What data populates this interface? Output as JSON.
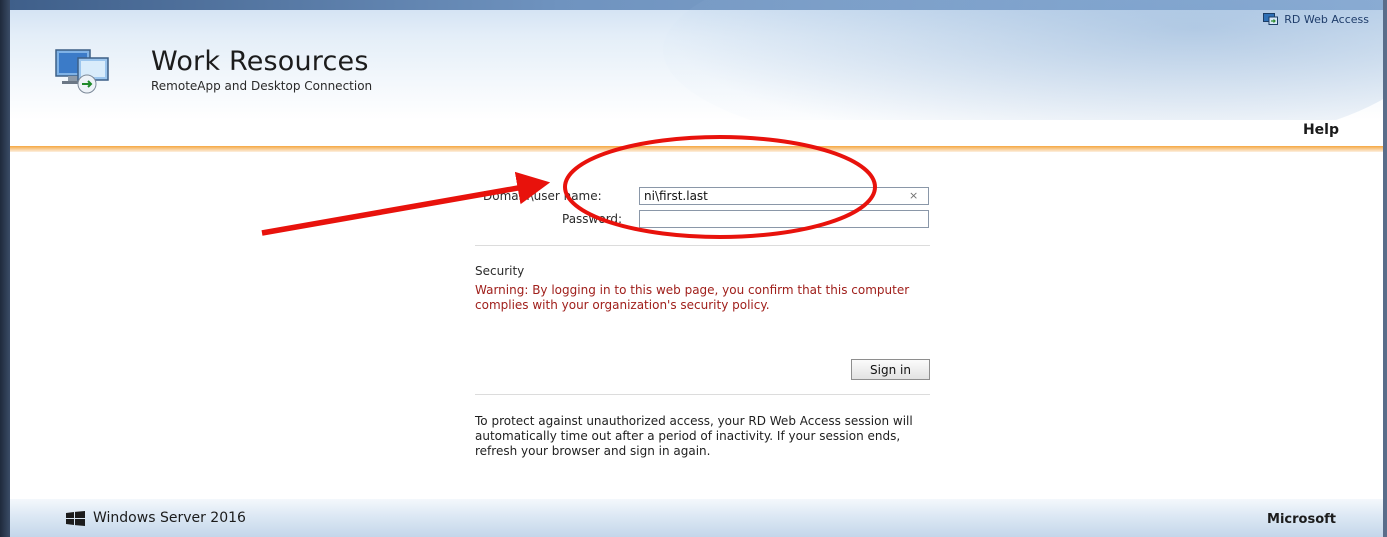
{
  "header": {
    "rd_web_access": "RD Web Access",
    "title": "Work Resources",
    "subtitle": "RemoteApp and Desktop Connection",
    "help": "Help"
  },
  "login": {
    "username_label": "Domain\\user name:",
    "username_value": "ni\\first.last",
    "clear_glyph": "×",
    "password_label": "Password:",
    "password_value": "",
    "security_title": "Security",
    "warning": "Warning: By logging in to this web page, you confirm that this computer complies with your organization's security policy.",
    "sign_in": "Sign in",
    "timeout_info": "To protect against unauthorized access, your RD Web Access session will automatically time out after a period of inactivity. If your session ends, refresh your browser and sign in again."
  },
  "footer": {
    "os": "Windows Server 2016",
    "vendor": "Microsoft"
  },
  "colors": {
    "accent_orange": "#f5a640",
    "warning_red": "#a0201c",
    "annotation_red": "#e8120c"
  },
  "icons": [
    "rd-web-access-icon",
    "remoteapp-logo-icon",
    "windows-logo-icon",
    "clear-icon"
  ]
}
